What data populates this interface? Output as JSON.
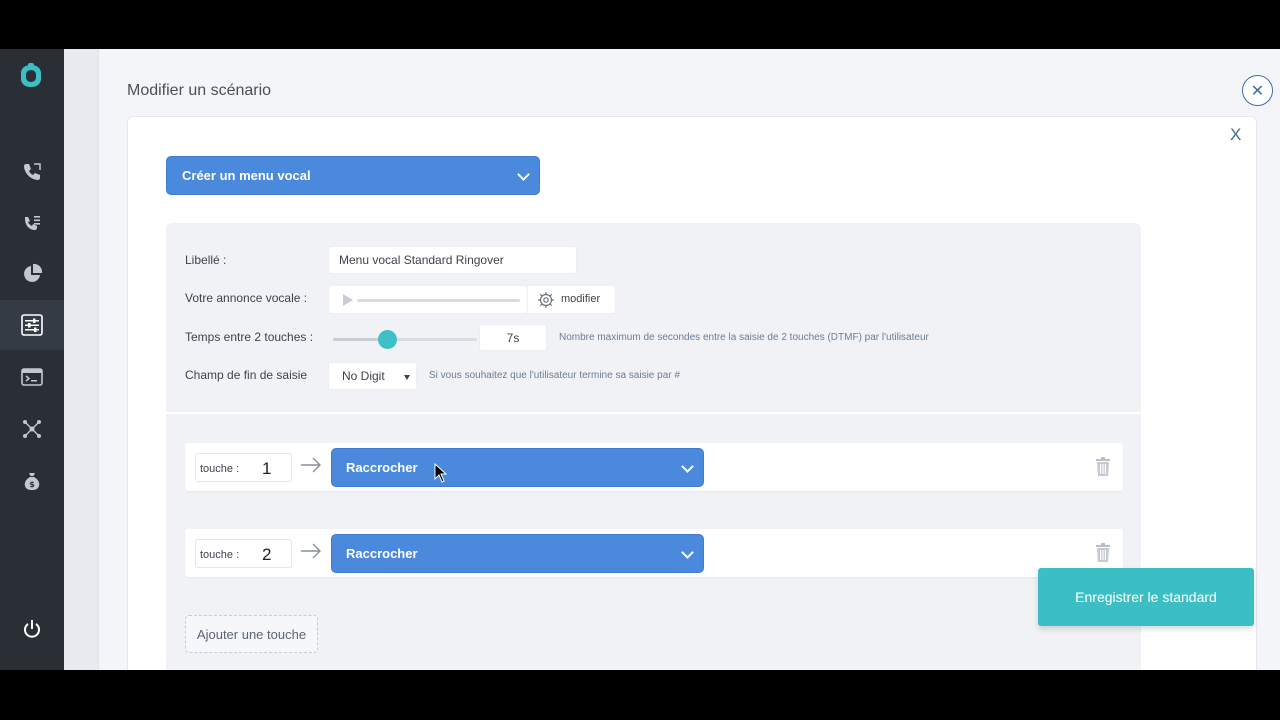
{
  "panel": {
    "title": "Modifier un scénario",
    "close_card_label": "X"
  },
  "menu_type": {
    "selected": "Créer un menu vocal"
  },
  "config": {
    "libelle_label": "Libellé :",
    "libelle_value": "Menu vocal Standard Ringover",
    "annonce_label": "Votre annonce vocale :",
    "annonce_modify": "modifier",
    "temps_label": "Temps entre 2 touches :",
    "temps_value": "7s",
    "temps_slider_fraction": 0.38,
    "temps_hint": "Nombre maximum de secondes entre la saisie de 2 touches (DTMF) par l'utilisateur",
    "fin_label": "Champ de fin de saisie",
    "fin_value": "No Digit",
    "fin_hint": "Si vous souhaitez que l'utilisateur termine sa saisie par #"
  },
  "keys": [
    {
      "label": "touche :",
      "number": "1",
      "action": "Raccrocher"
    },
    {
      "label": "touche :",
      "number": "2",
      "action": "Raccrocher"
    }
  ],
  "add_key_label": "Ajouter une touche",
  "save_label": "Enregistrer le standard",
  "colors": {
    "accent_blue": "#4a89dc",
    "accent_teal": "#3cbfc4",
    "sidebar": "#2a2f36"
  },
  "sidebar_icons": [
    "logo-icon",
    "phone-icon",
    "call-list-icon",
    "pie-chart-icon",
    "settings-sliders-icon",
    "terminal-icon",
    "network-icon",
    "money-bag-icon",
    "power-icon"
  ]
}
